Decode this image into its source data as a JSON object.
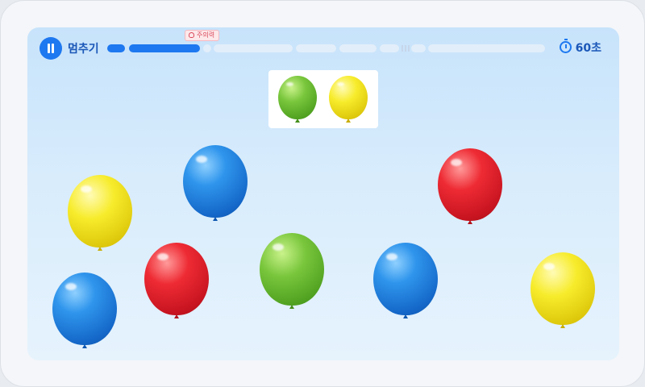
{
  "toolbar": {
    "pause_label": "멈추기",
    "pause_icon": "pause-icon",
    "hint_label": "주의력",
    "hint_icon": "lightbulb-icon",
    "timer_value": "60초",
    "timer_icon": "stopwatch-icon",
    "progress_completed_segments": 2
  },
  "target": {
    "balloons": [
      "green",
      "yellow"
    ]
  },
  "field": {
    "balloons": [
      "yellow",
      "blue",
      "red",
      "blue",
      "red",
      "green",
      "blue",
      "yellow"
    ]
  },
  "colors": {
    "accent": "#1e78f0",
    "blue": "#1f7fe0",
    "red": "#e3202b",
    "green": "#6bbb32",
    "yellow": "#f2e21e"
  }
}
